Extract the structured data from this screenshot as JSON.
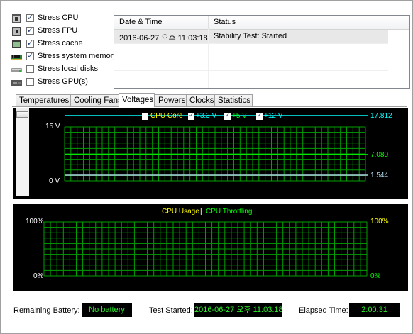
{
  "stress_options": [
    {
      "label": "Stress CPU",
      "checked": true,
      "icon": "cpu-icon"
    },
    {
      "label": "Stress FPU",
      "checked": true,
      "icon": "fpu-icon"
    },
    {
      "label": "Stress cache",
      "checked": true,
      "icon": "cache-icon"
    },
    {
      "label": "Stress system memory",
      "checked": true,
      "icon": "memory-icon"
    },
    {
      "label": "Stress local disks",
      "checked": false,
      "icon": "disk-icon"
    },
    {
      "label": "Stress GPU(s)",
      "checked": false,
      "icon": "gpu-icon"
    }
  ],
  "log": {
    "columns": [
      "Date & Time",
      "Status"
    ],
    "rows": [
      {
        "datetime": "2016-06-27 오후 11:03:18",
        "status": "Stability Test: Started"
      }
    ]
  },
  "tabs": [
    "Temperatures",
    "Cooling Fans",
    "Voltages",
    "Powers",
    "Clocks",
    "Statistics"
  ],
  "active_tab": "Voltages",
  "voltage_chart": {
    "legend": [
      {
        "label": "CPU Core",
        "checked": false,
        "color": "#ffff00"
      },
      {
        "label": "+3.3 V",
        "checked": true,
        "color": "#00ffff"
      },
      {
        "label": "+5 V",
        "checked": true,
        "color": "#00ff00"
      },
      {
        "label": "+12 V",
        "checked": true,
        "color": "#00ffff"
      }
    ],
    "y_max_label": "15 V",
    "y_min_label": "0 V",
    "readouts": [
      {
        "value": "17.812",
        "color": "#00ffff"
      },
      {
        "value": "7.080",
        "color": "#00ff00"
      },
      {
        "value": "1.544",
        "color": "#add8e6"
      }
    ]
  },
  "cpu_chart": {
    "title_left": "CPU Usage",
    "title_sep": "|",
    "title_right": "CPU Throttling",
    "title_left_color": "#ffff00",
    "title_right_color": "#00ff00",
    "left_max": "100%",
    "left_min": "0%",
    "right_max": "100%",
    "right_min": "0%"
  },
  "status": {
    "battery_label": "Remaining Battery:",
    "battery_value": "No battery",
    "started_label": "Test Started:",
    "started_value": "2016-06-27 오후 11:03:18",
    "elapsed_label": "Elapsed Time:",
    "elapsed_value": "2:00:31"
  },
  "colors": {
    "grid": "#00a000",
    "text_green": "#2af02a",
    "text_yellow": "#ffff00"
  }
}
